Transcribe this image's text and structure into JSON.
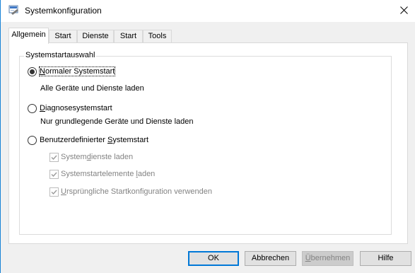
{
  "window": {
    "title": "Systemkonfiguration",
    "icon": "msconfig-icon"
  },
  "tabs": [
    {
      "label": "Allgemein",
      "active": true
    },
    {
      "label": "Start",
      "active": false
    },
    {
      "label": "Dienste",
      "active": false
    },
    {
      "label": "Start",
      "active": false
    },
    {
      "label": "Tools",
      "active": false
    }
  ],
  "group": {
    "title": "Systemstartauswahl"
  },
  "options": {
    "normal": {
      "pre": "",
      "mnemonic": "N",
      "post": "ormaler Systemstart",
      "description": "Alle Geräte und Dienste laden",
      "selected": true
    },
    "diagnostic": {
      "pre": "",
      "mnemonic": "D",
      "post": "iagnosesystemstart",
      "description": "Nur grundlegende Geräte und Dienste laden",
      "selected": false
    },
    "custom": {
      "pre": "Benutzerdefinierter ",
      "mnemonic": "S",
      "post": "ystemstart",
      "selected": false
    }
  },
  "checkboxes": {
    "services": {
      "pre": "System",
      "mnemonic": "d",
      "post": "ienste laden",
      "checked": true
    },
    "startup": {
      "pre": "Systemstartelemente ",
      "mnemonic": "l",
      "post": "aden",
      "checked": true
    },
    "original": {
      "pre": "",
      "mnemonic": "U",
      "post": "rsprüngliche Startkonfiguration verwenden",
      "checked": true
    }
  },
  "buttons": {
    "ok": "OK",
    "cancel": "Abbrechen",
    "apply_mnemonic": "Ü",
    "apply_post": "bernehmen",
    "help": "Hilfe"
  }
}
